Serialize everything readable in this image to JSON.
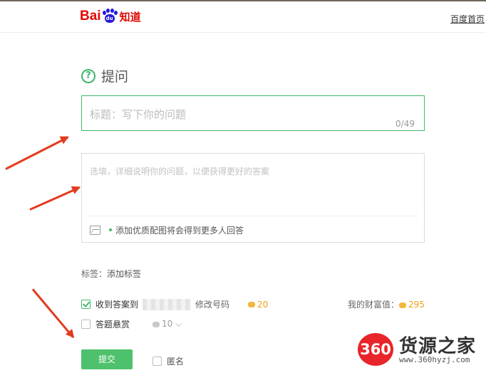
{
  "header": {
    "logo_text_bai": "Bai",
    "logo_paw_text": "du",
    "logo_text_zhidao": "知道",
    "home_link": "百度首页"
  },
  "page": {
    "heading": "提问",
    "heading_icon": "question-circle-icon"
  },
  "title_input": {
    "placeholder": "标题：写下你的问题",
    "count": "0/49"
  },
  "description_input": {
    "placeholder": "选填，详细说明你的问题，以便获得更好的答案",
    "image_icon": "image-icon",
    "tip": "添加优质配图将会得到更多人回答"
  },
  "tags": {
    "label": "标签：",
    "add_label": "添加标签"
  },
  "options": {
    "notify_label": "收到答案到",
    "notify_checked": true,
    "notify_suffix": "修改号码",
    "notify_cost": "20",
    "reward_label": "答题悬赏",
    "reward_checked": false,
    "reward_value": "10",
    "wealth_label": "我的财富值：",
    "wealth_value": "295"
  },
  "actions": {
    "submit_label": "提交",
    "anonymous_label": "匿名",
    "anonymous_checked": false
  },
  "watermark": {
    "badge": "360",
    "name": "货源之家",
    "url": "www.360hyzj.com"
  },
  "colors": {
    "accent_green": "#4dc16b",
    "baidu_red": "#e10601",
    "annotation_arrow": "#e23b1f",
    "coin_orange": "#f39c12"
  }
}
